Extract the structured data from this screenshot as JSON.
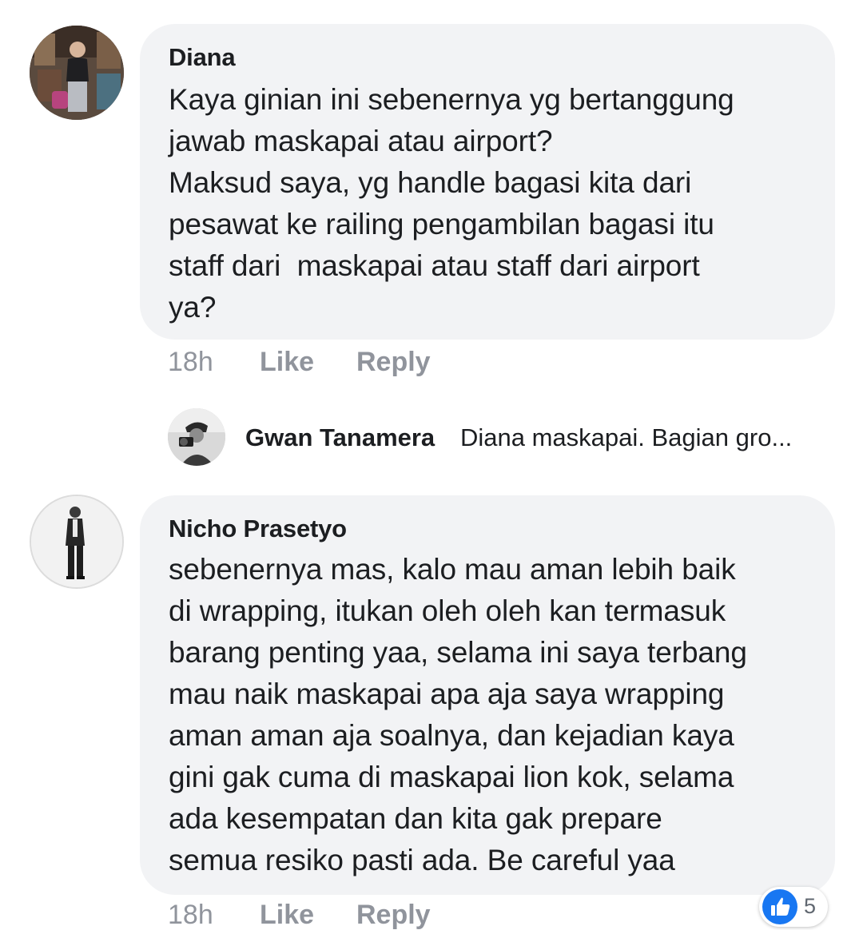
{
  "comments": [
    {
      "author": "Diana",
      "lines": [
        "Kaya ginian ini sebenernya yg bertanggung",
        "jawab maskapai atau airport?",
        "Maksud saya, yg handle bagasi kita dari",
        "pesawat ke railing pengambilan bagasi itu",
        "staff dari  maskapai atau staff dari airport",
        "ya?"
      ],
      "time": "18h",
      "like_label": "Like",
      "reply_label": "Reply"
    },
    {
      "author": "Nicho Prasetyo",
      "lines": [
        "sebenernya mas, kalo mau aman lebih baik",
        "di wrapping, itukan oleh oleh kan termasuk",
        "barang penting yaa, selama ini saya terbang",
        "mau naik maskapai apa aja saya wrapping",
        "aman aman aja soalnya, dan kejadian kaya",
        "gini gak cuma di maskapai lion kok, selama",
        "ada kesempatan dan kita gak prepare",
        "semua resiko pasti ada. Be careful yaa"
      ],
      "time": "18h",
      "like_label": "Like",
      "reply_label": "Reply",
      "reaction": {
        "icon": "like-thumb-icon",
        "count": "5",
        "color": "#1877f2"
      }
    }
  ],
  "reply_preview": {
    "author": "Gwan Tanamera",
    "text": "Diana maskapai.  Bagian gro..."
  },
  "colors": {
    "bubble": "#f2f3f5",
    "meta_text": "#90949c",
    "body_text": "#1c1e21",
    "like_blue": "#1877f2"
  }
}
